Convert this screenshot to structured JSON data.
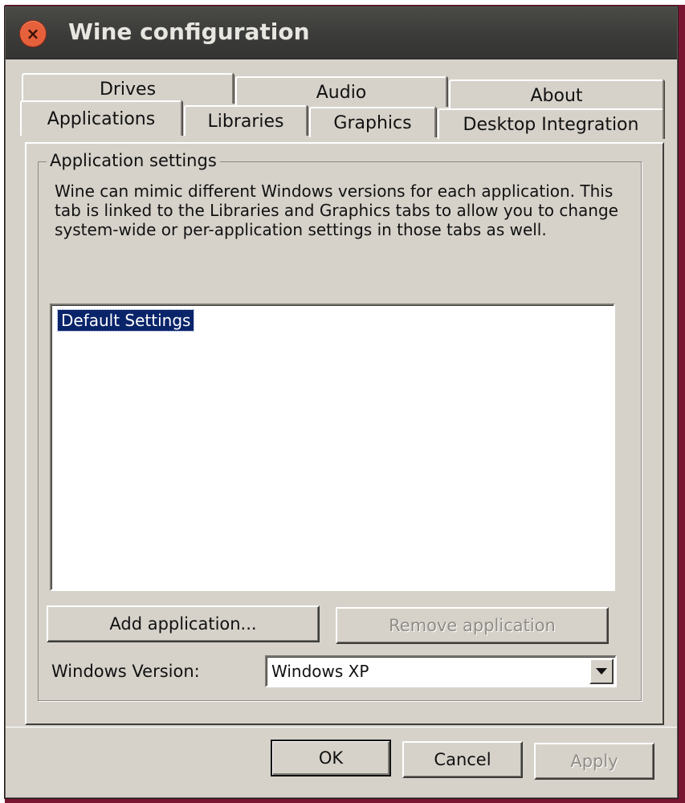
{
  "window": {
    "title": "Wine configuration",
    "close_glyph": "×"
  },
  "tabs_row_back": [
    {
      "label": "Drives"
    },
    {
      "label": "Audio"
    },
    {
      "label": "About"
    }
  ],
  "tabs_row_front": [
    {
      "label": "Applications",
      "active": true
    },
    {
      "label": "Libraries"
    },
    {
      "label": "Graphics"
    },
    {
      "label": "Desktop Integration"
    }
  ],
  "applications": {
    "group_title": "Application settings",
    "description": "Wine can mimic different Windows versions for each application.  This tab is linked to the Libraries and Graphics tabs to allow you to change system-wide or per-application settings in those tabs as well.",
    "list_items": [
      "Default Settings"
    ],
    "add_button": "Add application...",
    "remove_button": "Remove application",
    "version_label": "Windows Version:",
    "version_value": "Windows XP"
  },
  "footer": {
    "ok": "OK",
    "cancel": "Cancel",
    "apply": "Apply"
  },
  "colors": {
    "accent_selection": "#0a246a",
    "window_bg": "#d6d2ca",
    "close_button": "#e5603b"
  }
}
